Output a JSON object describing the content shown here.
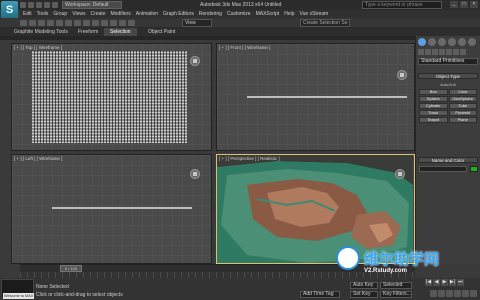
{
  "window": {
    "logo": "S",
    "workspace": "Workspace: Default",
    "title": "Autodesk 3ds Max 2013 x64      Untitled",
    "search_placeholder": "Type a keyword or phrase",
    "controls": [
      "_",
      "□",
      "×"
    ]
  },
  "menu": [
    "Edit",
    "Tools",
    "Group",
    "Views",
    "Create",
    "Modifiers",
    "Animation",
    "Graph Editors",
    "Rendering",
    "Customize",
    "MAXScript",
    "Help",
    "Vue xStream"
  ],
  "toolbar": {
    "view_select": "View",
    "named_selection": "Create Selection Se"
  },
  "ribbon_tabs": [
    "Graphite Modeling Tools",
    "Freeform",
    "Selection",
    "Object Paint"
  ],
  "viewports": {
    "top_label": "[ + ] [ Top ] [ Wireframe ]",
    "front_label": "[ + ] [ Front ] [ Wireframe ]",
    "left_label": "[ + ] [ Left ] [ Wireframe ]",
    "persp_label": "[ + ] [ Perspective ] [ Realistic ]"
  },
  "command_panel": {
    "dropdown": "Standard Primitives",
    "object_type_header": "Object Type",
    "autogrid": "AutoGrid",
    "objects": [
      "Box",
      "Cone",
      "Sphere",
      "GeoSphere",
      "Cylinder",
      "Tube",
      "Torus",
      "Pyramid",
      "Teapot",
      "Plane"
    ],
    "name_color_header": "Name and Color",
    "color": "#1cb31c"
  },
  "timeline": {
    "slider": "0 / 100"
  },
  "status": {
    "maxscript_text": "Welcome to MAX",
    "line1": "None Selected",
    "line2": "Click or click-and-drag to select objects",
    "add_time_tag": "Add Time Tag",
    "key_mode": "Selected",
    "set_key": "Set Key",
    "key_filters": "Key Filters...",
    "auto_key": "Auto Key",
    "transport": [
      "|◀",
      "◀",
      "▶",
      "▶|",
      "⏭"
    ]
  },
  "watermark": {
    "main": "维尔助学网",
    "sub": "V2.Rstudy.com"
  }
}
